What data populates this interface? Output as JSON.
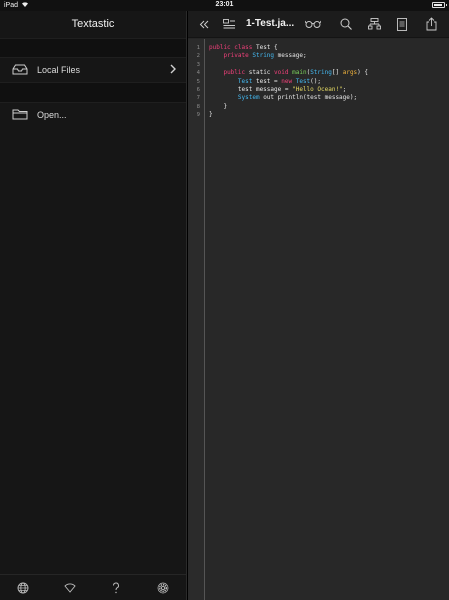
{
  "statusbar": {
    "device": "iPad",
    "time": "23:01",
    "battery_level": 0.9
  },
  "sidebar": {
    "title": "Textastic",
    "items": [
      {
        "label": "Local Files",
        "icon": "inbox-tray-icon",
        "has_chevron": true
      },
      {
        "label": "Open...",
        "icon": "folder-icon",
        "has_chevron": false
      }
    ],
    "bottom_icons": [
      "globe-icon",
      "wifi-icon",
      "help-icon",
      "gear-icon"
    ]
  },
  "editor": {
    "filename": "1-Test.ja...",
    "toolbar_icons": [
      "collapse-sidebar-icon",
      "symbol-list-icon",
      "glasses-icon",
      "search-icon",
      "tree-structure-icon",
      "document-icon",
      "share-icon"
    ],
    "line_numbers": [
      "1",
      "2",
      "3",
      "4",
      "5",
      "6",
      "7",
      "8",
      "9"
    ],
    "code": [
      [
        [
          "kw",
          "public class "
        ],
        [
          "",
          "Test {"
        ]
      ],
      [
        [
          "",
          "    "
        ],
        [
          "kw",
          "private "
        ],
        [
          "ty",
          "String "
        ],
        [
          "",
          "message;"
        ]
      ],
      [
        [
          "",
          ""
        ]
      ],
      [
        [
          "",
          "    "
        ],
        [
          "kw",
          "public "
        ],
        [
          "",
          "static "
        ],
        [
          "kw",
          "void "
        ],
        [
          "fn",
          "main"
        ],
        [
          "",
          "("
        ],
        [
          "ty",
          "String"
        ],
        [
          "",
          "[] "
        ],
        [
          "pa",
          "args"
        ],
        [
          "",
          ") {"
        ]
      ],
      [
        [
          "",
          "        "
        ],
        [
          "ty",
          "Test "
        ],
        [
          "",
          "test = "
        ],
        [
          "kw",
          "new "
        ],
        [
          "ty",
          "Test"
        ],
        [
          "",
          "();"
        ]
      ],
      [
        [
          "",
          "        test message = "
        ],
        [
          "st",
          "\"Hello Ocean!\""
        ],
        [
          "",
          ";"
        ]
      ],
      [
        [
          "",
          "        "
        ],
        [
          "ty",
          "System "
        ],
        [
          "",
          "out println(test message);"
        ]
      ],
      [
        [
          "",
          "    }"
        ]
      ],
      [
        [
          "",
          "}"
        ]
      ]
    ]
  },
  "colors": {
    "keyword": "#f0407a",
    "type": "#44b8f0",
    "function": "#7bd35b",
    "param": "#f0b23c",
    "string": "#e7dc64"
  }
}
